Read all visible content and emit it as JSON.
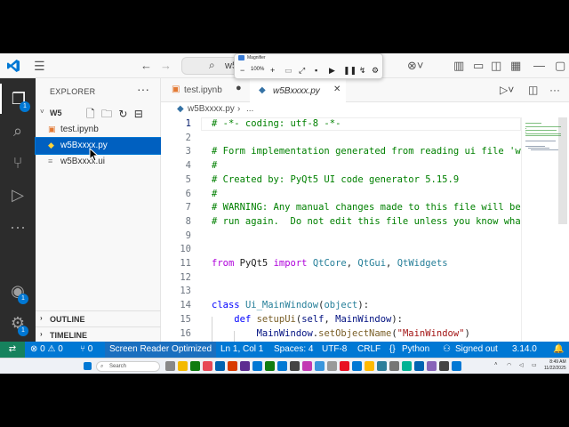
{
  "titlebar": {
    "search_text": "w5",
    "nav_back": "←",
    "nav_forward": "→"
  },
  "magnifier": {
    "title": "Magnifier",
    "zoom_level": "100%",
    "minus": "−",
    "plus": "+"
  },
  "activitybar": {
    "explorer_badge": "1",
    "accounts_badge": "1",
    "settings_badge": "1"
  },
  "sidebar": {
    "title": "EXPLORER",
    "folder_name": "W5",
    "files": [
      {
        "name": "test.ipynb",
        "icon": "notebook-icon"
      },
      {
        "name": "w5Bxxxx.py",
        "icon": "python-icon"
      },
      {
        "name": "w5Bxxxx.ui",
        "icon": "ui-file-icon"
      }
    ],
    "outline_label": "OUTLINE",
    "timeline_label": "TIMELINE"
  },
  "tabs": [
    {
      "label": "test.ipynb",
      "modified": true
    },
    {
      "label": "w5Bxxxx.py",
      "active": true
    }
  ],
  "breadcrumb": {
    "file": "w5Bxxxx.py",
    "more": "..."
  },
  "editor": {
    "line_numbers": [
      "1",
      "2",
      "3",
      "4",
      "5",
      "6",
      "7",
      "8",
      "9",
      "10",
      "11",
      "12",
      "13",
      "14",
      "15",
      "16"
    ],
    "lines": [
      "# -*- coding: utf-8 -*-",
      "",
      "# Form implementation generated from reading ui file 'w",
      "#",
      "# Created by: PyQt5 UI code generator 5.15.9",
      "#",
      "# WARNING: Any manual changes made to this file will be",
      "# run again.  Do not edit this file unless you know wha",
      "",
      "",
      "from PyQt5 import QtCore, QtGui, QtWidgets",
      "",
      "",
      "class Ui_MainWindow(object):",
      "    def setupUi(self, MainWindow):",
      "        MainWindow.setObjectName(\"MainWindow\")"
    ]
  },
  "statusbar": {
    "remote": "⇄",
    "problems": "⊗ 0 ⚠ 0",
    "ports": "⑂ 0",
    "screen_reader": "Screen Reader Optimized",
    "position": "Ln 1, Col 1",
    "spaces": "Spaces: 4",
    "encoding": "UTF-8",
    "eol": "CRLF",
    "language": "Python",
    "account": "Signed out",
    "version": "3.14.0"
  },
  "taskbar": {
    "search_placeholder": "Search",
    "time": "8:49 AM",
    "date": "11/22/2025"
  },
  "colors": {
    "accent": "#0078d4",
    "statusbar": "#0078d4",
    "remote": "#16825d",
    "comment": "#008000",
    "keyword": "#af00db",
    "class_kw": "#0000ff",
    "type": "#267f99",
    "func": "#795e26",
    "string": "#a31515",
    "param": "#001080"
  }
}
